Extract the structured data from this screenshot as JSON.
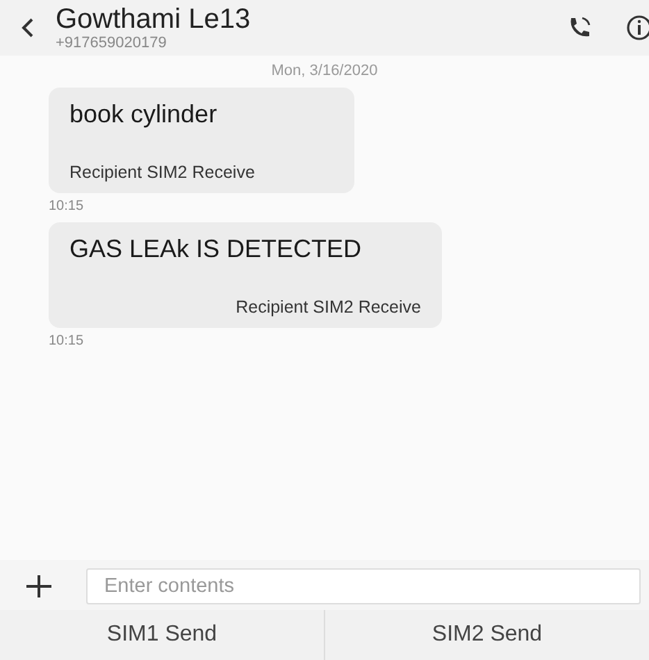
{
  "contact": {
    "name": "Gowthami Le13",
    "number": "+917659020179"
  },
  "date": "Mon, 3/16/2020",
  "messages": [
    {
      "text": "book cylinder",
      "sim_label": "Recipient SIM2 Receive",
      "time": "10:15"
    },
    {
      "text": "GAS LEAk IS DETECTED",
      "sim_label": "Recipient SIM2 Receive",
      "time": "10:15"
    }
  ],
  "composer": {
    "placeholder": "Enter contents"
  },
  "send_buttons": [
    "SIM1 Send",
    "SIM2 Send"
  ]
}
